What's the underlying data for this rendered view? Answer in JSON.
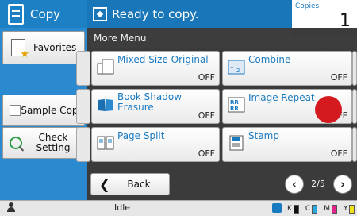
{
  "header": {
    "app_title": "Copy",
    "status": "Ready to copy.",
    "copies_label": "Copies",
    "copies_value": "1"
  },
  "sidebar": {
    "favorites": "Favorites",
    "sample_copy": "Sample Copy",
    "check_setting": "Check Setting"
  },
  "menu": {
    "title": "More Menu",
    "tiles": [
      {
        "name": "Mixed Size Original",
        "value": "OFF",
        "icon": "mixed-size-icon"
      },
      {
        "name": "Combine",
        "value": "OFF",
        "icon": "combine-icon"
      },
      {
        "name": "Book Shadow Erasure",
        "value": "OFF",
        "icon": "book-icon"
      },
      {
        "name": "Image Repeat",
        "value": "OFF",
        "icon": "image-repeat-icon"
      },
      {
        "name": "Page Split",
        "value": "OFF",
        "icon": "page-split-icon"
      },
      {
        "name": "Stamp",
        "value": "OFF",
        "icon": "stamp-icon"
      }
    ]
  },
  "nav": {
    "back": "Back",
    "page_indicator": "2/5"
  },
  "statusbar": {
    "machine_status": "Idle",
    "toner": [
      {
        "label": "K",
        "color": "#111111"
      },
      {
        "label": "C",
        "color": "#29a8e0"
      },
      {
        "label": "M",
        "color": "#e0248c"
      },
      {
        "label": "Y",
        "color": "#f2e21a"
      }
    ]
  },
  "colors": {
    "accent": "#1976b8",
    "link_text": "#1a7ac0",
    "indicator": "#d41a1f"
  }
}
